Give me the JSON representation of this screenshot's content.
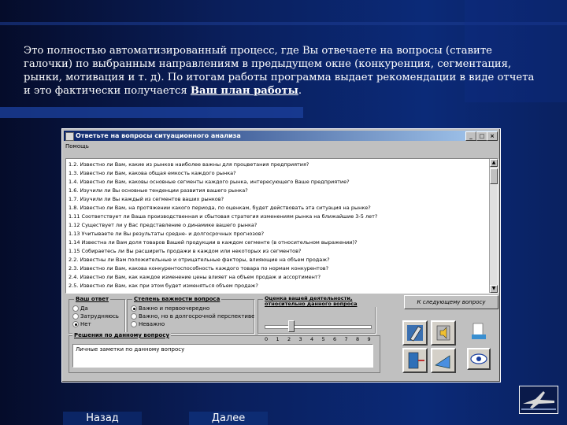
{
  "intro": {
    "text": "Это полностью автоматизированный процесс, где Вы отвечаете на вопросы (ставите галочки) по выбранным направлениям в предыдущем окне (конкуренция, сегментация, рынки, мотивация и т. д). По итогам работы программа выдает рекомендации в виде отчета и это фактически получается ",
    "bold": "Ваш план работы",
    "end": "."
  },
  "window": {
    "title": "Ответьте на вопросы ситуационного анализа",
    "min": "_",
    "max": "□",
    "close": "×",
    "menu": "Помощь"
  },
  "questions": [
    "1.2. Известно ли Вам, какие из рынков наиболее важны для процветания предприятия?",
    "1.3. Известно ли Вам, какова общая емкость каждого рынка?",
    "1.4. Известно ли Вам, каковы основные сегменты каждого рынка, интересующего Ваше предприятие?",
    "1.6. Изучили ли Вы основные тенденции развития вашего рынка?",
    "1.7. Изучили ли Вы каждый из сегментов ваших рынков?",
    "1.8. Известно ли Вам, на протяжении какого периода, по оценкам, будет действовать эта ситуация на рынке?",
    "1.11 Соответствует ли Ваша производственная и сбытовая стратегия изменениям рынка на ближайшие 3-5 лет?",
    "1.12 Существует ли у Вас представление о динамике вашего рынка?",
    "1.13 Учитываете ли Вы результаты средне- и долгосрочных прогнозов?",
    "1.14 Известна ли Вам доля товаров Вашей продукции в каждом сегменте (в относительном выражении)?",
    "1.15 Собираетесь ли Вы расширить продажи в каждом или некоторых из сегментов?",
    "2.2. Известны ли Вам положительные и отрицательные факторы, влияющие на объем продаж?",
    "2.3. Известно ли Вам, какова конкурентоспособность каждого товара по нормам конкурентов?",
    "2.4. Известно ли Вам, как каждое изменение цены влияет на объем продаж и ассортимент?",
    "2.5. Известно ли Вам, как при этом будет изменяться объем продаж?"
  ],
  "answer_group": {
    "title": "Ваш ответ",
    "options": [
      "Да",
      "Затрудняюсь",
      "Нет"
    ],
    "selected": 2
  },
  "importance_group": {
    "title": "Степень важности вопроса",
    "options": [
      "Важно и первоочередно",
      "Важно, но в долгосрочной перспективе",
      "Неважно"
    ],
    "selected": 0
  },
  "effectiveness_group": {
    "title": "Оценка вашей деятельности, относительно данного вопроса",
    "ticks": [
      "0",
      "1",
      "2",
      "3",
      "4",
      "5",
      "6",
      "7",
      "8",
      "9"
    ],
    "value": 2
  },
  "next_question_button": "К следующему вопросу",
  "decision": {
    "title": "Решения по данному вопросу",
    "value": "Личные заметки по данному вопросу"
  },
  "nav": {
    "back": "Назад",
    "next": "Далее"
  },
  "colors": {
    "background": "#04123d",
    "title_bar": "#0a246a",
    "window": "#c0c0c0"
  }
}
